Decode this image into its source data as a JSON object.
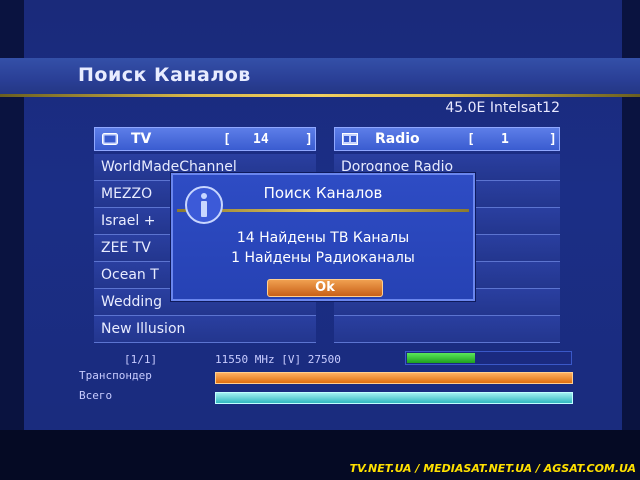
{
  "header": {
    "title": "Поиск Каналов",
    "satellite": "45.0E Intelsat12"
  },
  "tv_panel": {
    "label": "TV",
    "count": "14"
  },
  "radio_panel": {
    "label": "Radio",
    "count": "1"
  },
  "tv_channels": [
    "WorldMadeChannel",
    "MEZZO",
    "Israel +",
    "ZEE TV",
    "Ocean T",
    "Wedding",
    "New Illusion"
  ],
  "radio_channels": [
    "Dorognoe Radio",
    "",
    "",
    "",
    "",
    "",
    ""
  ],
  "status": {
    "page": "[1/1]",
    "transponder_info": "11550 MHz [V] 27500",
    "transponder_label": "Транспондер",
    "total_label": "Всего",
    "signal_level": 0.42,
    "transponder_progress": 1.0,
    "total_progress": 1.0
  },
  "dialog": {
    "title": "Поиск Каналов",
    "line1": "14 Найдены ТВ Каналы",
    "line2": "1 Найдены Радиоканалы",
    "ok_label": "Ok"
  },
  "watermark": "TV.NET.UA / MEDIASAT.NET.UA / AGSAT.COM.UA",
  "icons": {
    "tv": "tv-icon",
    "radio": "radio-icon",
    "info": "info-icon"
  },
  "colors": {
    "accent_orange": "#e07010",
    "accent_cyan": "#30b8c0",
    "signal_green": "#1ea01e",
    "gold_line": "#f0d060"
  }
}
